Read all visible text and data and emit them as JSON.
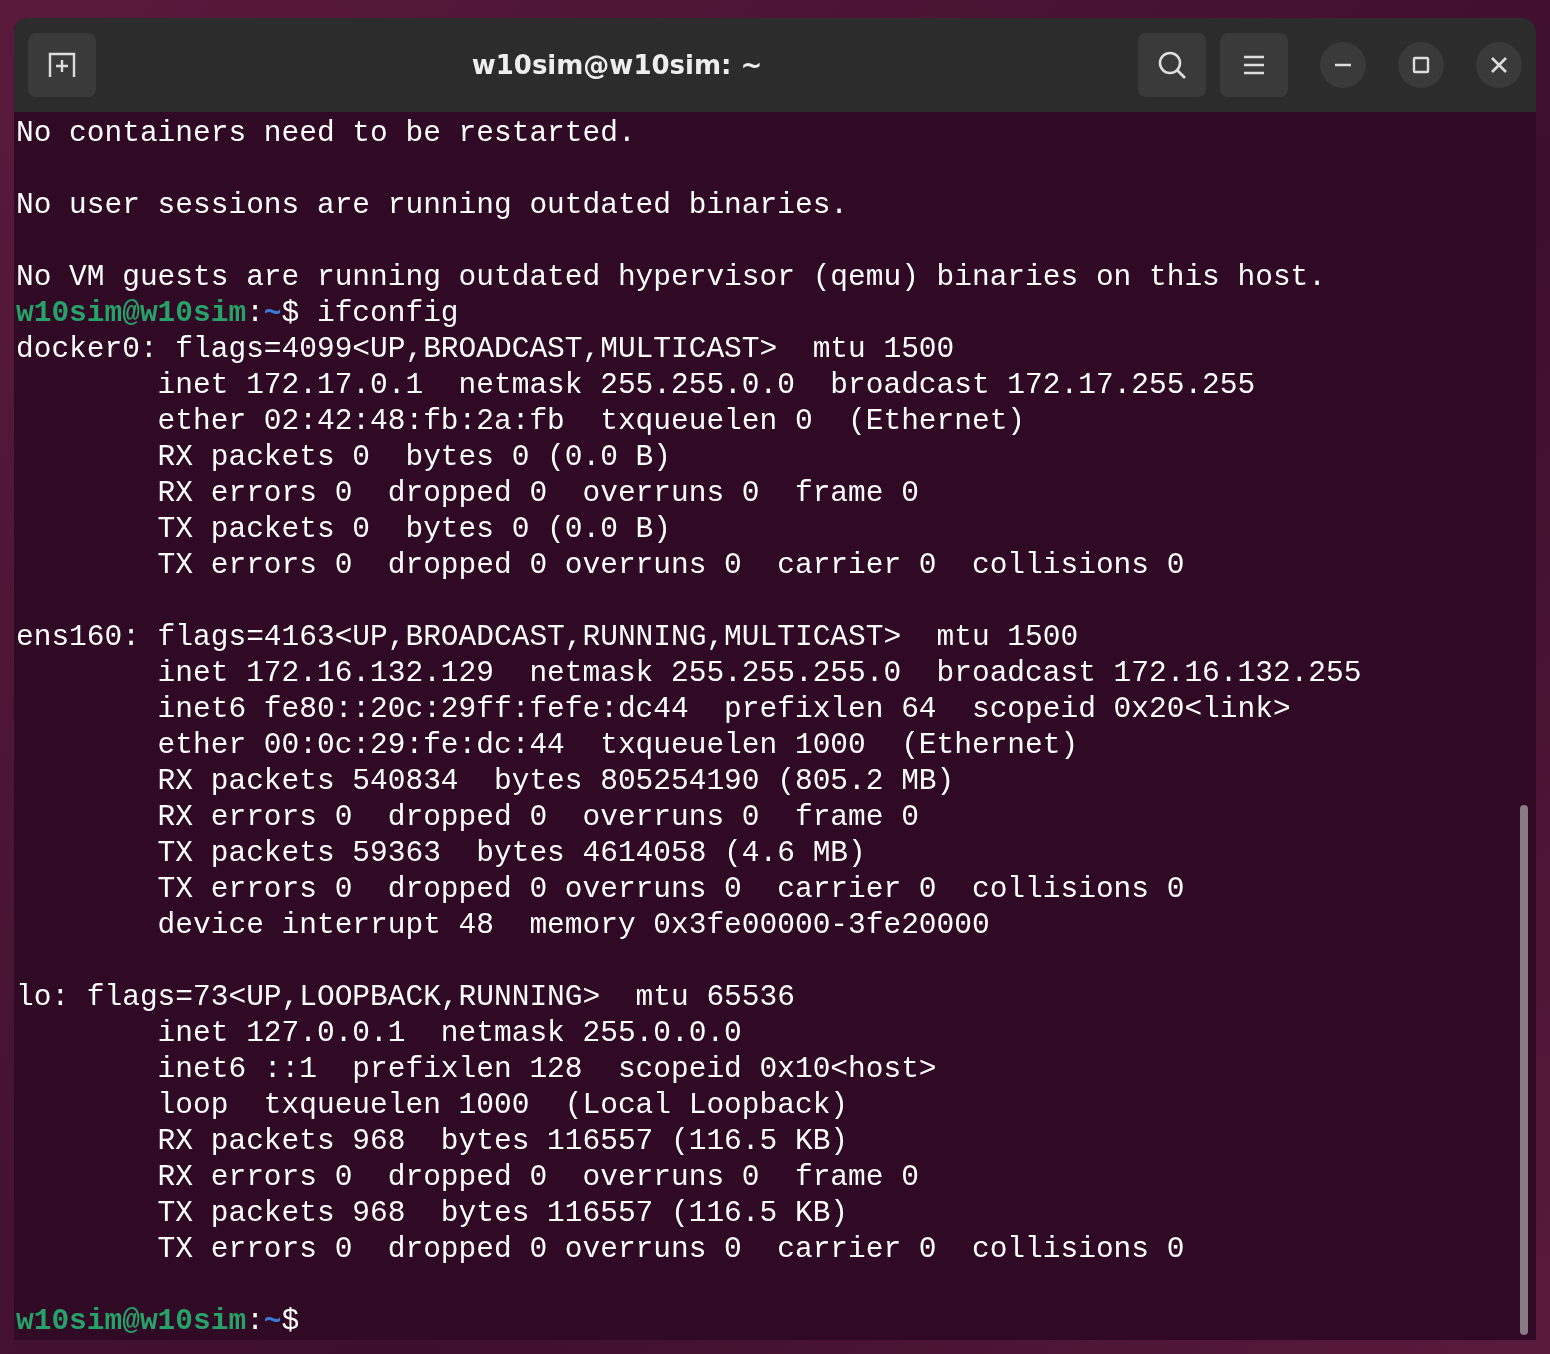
{
  "window": {
    "title": "w10sim@w10sim: ~"
  },
  "terminal": {
    "lines": [
      {
        "kind": "output",
        "text": "No containers need to be restarted."
      },
      {
        "kind": "blank"
      },
      {
        "kind": "output",
        "text": "No user sessions are running outdated binaries."
      },
      {
        "kind": "blank"
      },
      {
        "kind": "output",
        "text": "No VM guests are running outdated hypervisor (qemu) binaries on this host."
      },
      {
        "kind": "prompt",
        "user": "w10sim@w10sim",
        "separator": ":",
        "path": "~",
        "symbol": "$",
        "command": "ifconfig"
      },
      {
        "kind": "output",
        "text": "docker0: flags=4099<UP,BROADCAST,MULTICAST>  mtu 1500"
      },
      {
        "kind": "output",
        "text": "        inet 172.17.0.1  netmask 255.255.0.0  broadcast 172.17.255.255"
      },
      {
        "kind": "output",
        "text": "        ether 02:42:48:fb:2a:fb  txqueuelen 0  (Ethernet)"
      },
      {
        "kind": "output",
        "text": "        RX packets 0  bytes 0 (0.0 B)"
      },
      {
        "kind": "output",
        "text": "        RX errors 0  dropped 0  overruns 0  frame 0"
      },
      {
        "kind": "output",
        "text": "        TX packets 0  bytes 0 (0.0 B)"
      },
      {
        "kind": "output",
        "text": "        TX errors 0  dropped 0 overruns 0  carrier 0  collisions 0"
      },
      {
        "kind": "blank"
      },
      {
        "kind": "output",
        "text": "ens160: flags=4163<UP,BROADCAST,RUNNING,MULTICAST>  mtu 1500"
      },
      {
        "kind": "output",
        "text": "        inet 172.16.132.129  netmask 255.255.255.0  broadcast 172.16.132.255"
      },
      {
        "kind": "output",
        "text": "        inet6 fe80::20c:29ff:fefe:dc44  prefixlen 64  scopeid 0x20<link>"
      },
      {
        "kind": "output",
        "text": "        ether 00:0c:29:fe:dc:44  txqueuelen 1000  (Ethernet)"
      },
      {
        "kind": "output",
        "text": "        RX packets 540834  bytes 805254190 (805.2 MB)"
      },
      {
        "kind": "output",
        "text": "        RX errors 0  dropped 0  overruns 0  frame 0"
      },
      {
        "kind": "output",
        "text": "        TX packets 59363  bytes 4614058 (4.6 MB)"
      },
      {
        "kind": "output",
        "text": "        TX errors 0  dropped 0 overruns 0  carrier 0  collisions 0"
      },
      {
        "kind": "output",
        "text": "        device interrupt 48  memory 0x3fe00000-3fe20000"
      },
      {
        "kind": "blank"
      },
      {
        "kind": "output",
        "text": "lo: flags=73<UP,LOOPBACK,RUNNING>  mtu 65536"
      },
      {
        "kind": "output",
        "text": "        inet 127.0.0.1  netmask 255.0.0.0"
      },
      {
        "kind": "output",
        "text": "        inet6 ::1  prefixlen 128  scopeid 0x10<host>"
      },
      {
        "kind": "output",
        "text": "        loop  txqueuelen 1000  (Local Loopback)"
      },
      {
        "kind": "output",
        "text": "        RX packets 968  bytes 116557 (116.5 KB)"
      },
      {
        "kind": "output",
        "text": "        RX errors 0  dropped 0  overruns 0  frame 0"
      },
      {
        "kind": "output",
        "text": "        TX packets 968  bytes 116557 (116.5 KB)"
      },
      {
        "kind": "output",
        "text": "        TX errors 0  dropped 0 overruns 0  carrier 0  collisions 0"
      },
      {
        "kind": "blank"
      },
      {
        "kind": "prompt",
        "user": "w10sim@w10sim",
        "separator": ":",
        "path": "~",
        "symbol": "$"
      }
    ]
  }
}
